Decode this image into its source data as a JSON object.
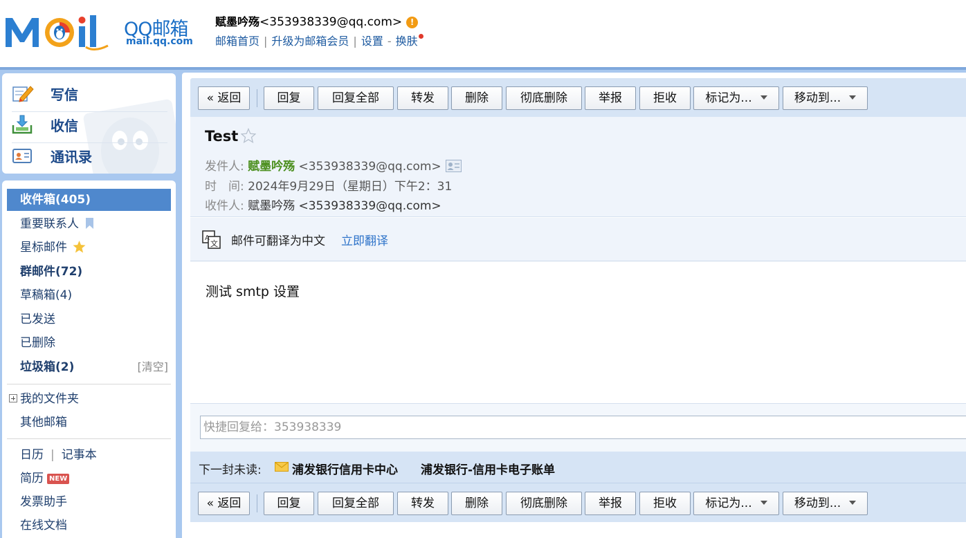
{
  "header": {
    "logo_text": "MOil",
    "logo_qq": "QQ邮箱",
    "logo_site": "mail.qq.com",
    "user_name": "赋墨吟殇",
    "user_email": "<353938339@qq.com>",
    "warn_symbol": "!",
    "links": {
      "home": "邮箱首页",
      "upgrade": "升级为邮箱会员",
      "settings": "设置",
      "dash": "-",
      "skin": "换肤",
      "sep": "|"
    }
  },
  "quick_actions": [
    {
      "label": "写信",
      "icon": "pencil-paper-icon"
    },
    {
      "label": "收信",
      "icon": "inbox-download-icon"
    },
    {
      "label": "通讯录",
      "icon": "address-card-icon"
    }
  ],
  "folders": {
    "inbox": "收件箱(405)",
    "vip": "重要联系人",
    "starred": "星标邮件",
    "group": "群邮件(72)",
    "drafts": "草稿箱(4)",
    "sent": "已发送",
    "deleted": "已删除",
    "spam": "垃圾箱(2)",
    "spam_clear": "[清空]",
    "my_folders": "我的文件夹",
    "other_mailbox": "其他邮箱",
    "calendar": "日历",
    "link_sep": "|",
    "notepad": "记事本",
    "resume": "简历",
    "resume_badge": "NEW",
    "invoice": "发票助手",
    "docs": "在线文档"
  },
  "toolbar": {
    "back": "« 返回",
    "reply": "回复",
    "reply_all": "回复全部",
    "forward": "转发",
    "delete": "删除",
    "perm_delete": "彻底删除",
    "report": "举报",
    "reject": "拒收",
    "mark_as": "标记为...",
    "move_to": "移动到..."
  },
  "mail": {
    "subject": "Test",
    "from_label": "发件人:",
    "from_name": "赋墨吟殇",
    "from_email": "<353938339@qq.com>",
    "time_label": "时　间:",
    "time_value": "2024年9月29日（星期日）下午2：31",
    "to_label": "收件人:",
    "to_value": "赋墨吟殇 <353938339@qq.com>",
    "translate_text": "邮件可翻译为中文",
    "translate_link": "立即翻译",
    "body": "测试 smtp 设置"
  },
  "quick_reply": {
    "placeholder": "快捷回复给：353938339"
  },
  "next_unread": {
    "label": "下一封未读:",
    "sender": "浦发银行信用卡中心",
    "subject": "浦发银行-信用卡电子账单"
  },
  "colors": {
    "frame_blue": "#a9c8ef",
    "toolbar_blue": "#d6e4f5",
    "active_folder": "#4f88cd",
    "sender_green": "#4b8f1e",
    "link_blue": "#2e73c9"
  }
}
